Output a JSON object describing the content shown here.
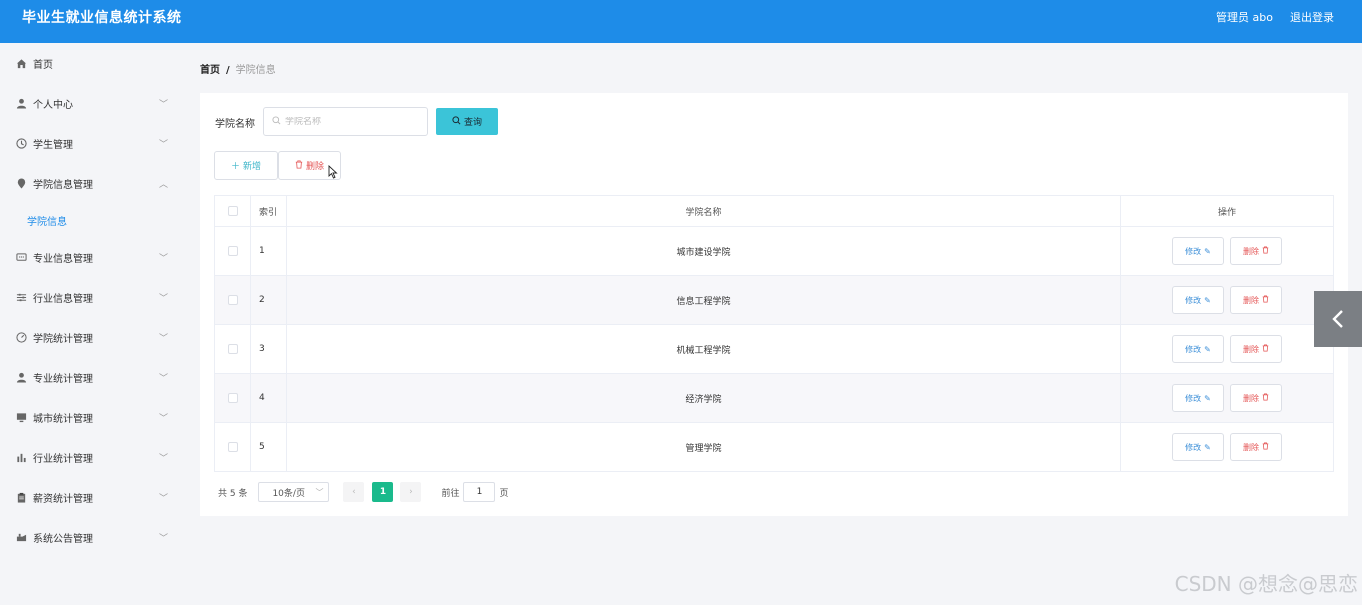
{
  "header": {
    "title": "毕业生就业信息统计系统",
    "user": "管理员 abo",
    "logout": "退出登录",
    "color": "#1e8ce8"
  },
  "sidebar": {
    "items": [
      {
        "label": "首页",
        "icon": "home-icon"
      },
      {
        "label": "个人中心",
        "icon": "user-icon",
        "expandable": true
      },
      {
        "label": "学生管理",
        "icon": "clock-icon",
        "expandable": true
      },
      {
        "label": "学院信息管理",
        "icon": "location-icon",
        "expandable": true,
        "expanded": true
      },
      {
        "label": "专业信息管理",
        "icon": "chat-icon",
        "expandable": true
      },
      {
        "label": "行业信息管理",
        "icon": "sliders-icon",
        "expandable": true
      },
      {
        "label": "学院统计管理",
        "icon": "gauge-icon",
        "expandable": true
      },
      {
        "label": "专业统计管理",
        "icon": "user-icon",
        "expandable": true
      },
      {
        "label": "城市统计管理",
        "icon": "monitor-icon",
        "expandable": true
      },
      {
        "label": "行业统计管理",
        "icon": "bar-chart-icon",
        "expandable": true
      },
      {
        "label": "薪资统计管理",
        "icon": "clipboard-icon",
        "expandable": true
      },
      {
        "label": "系统公告管理",
        "icon": "megaphone-icon",
        "expandable": true
      }
    ],
    "sub_active": "学院信息"
  },
  "breadcrumb": {
    "home": "首页",
    "sep": "/",
    "current": "学院信息"
  },
  "search": {
    "label": "学院名称",
    "placeholder": "学院名称",
    "button": "查询"
  },
  "actions": {
    "add": "新增",
    "delete": "删除"
  },
  "table": {
    "headers": {
      "index": "索引",
      "name": "学院名称",
      "ops": "操作"
    },
    "rows": [
      {
        "index": "1",
        "name": "城市建设学院"
      },
      {
        "index": "2",
        "name": "信息工程学院"
      },
      {
        "index": "3",
        "name": "机械工程学院"
      },
      {
        "index": "4",
        "name": "经济学院"
      },
      {
        "index": "5",
        "name": "管理学院"
      }
    ],
    "edit_label": "修改",
    "delete_label": "删除"
  },
  "pagination": {
    "total": "共 5 条",
    "page_size": "10条/页",
    "current": "1",
    "goto_prefix": "前往",
    "goto_value": "1",
    "goto_suffix": "页"
  },
  "watermark": "CSDN @想念@思恋",
  "colors": {
    "accent": "#3bc4d8",
    "active_page": "#1aba8c",
    "danger": "#e45454"
  }
}
